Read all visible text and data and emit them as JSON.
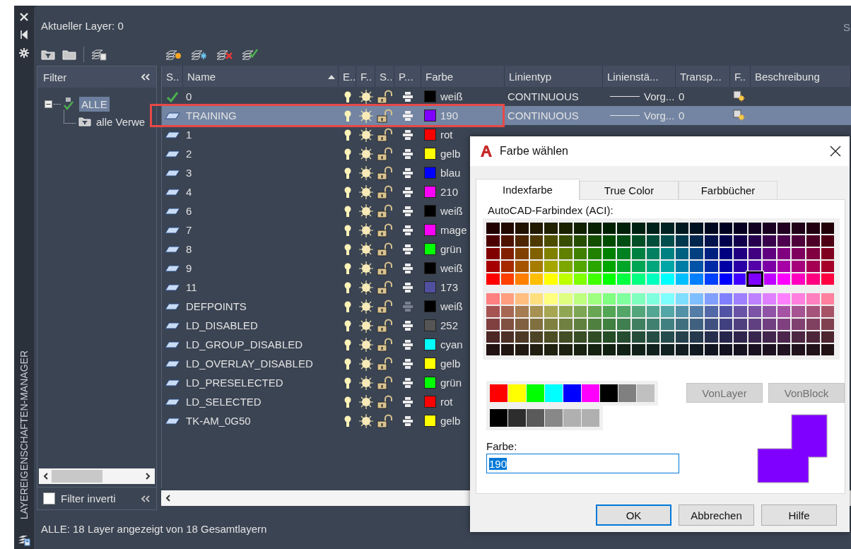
{
  "panel": {
    "title": "LAYEREIGENSCHAFTEN-MANAGER"
  },
  "current_layer": "Aktueller Layer: 0",
  "search": {
    "text": "S"
  },
  "filter_panel": {
    "title": "Filter",
    "tree": [
      {
        "label": "ALLE",
        "selected": true,
        "expanded": true,
        "children": [
          {
            "label": "alle Verwe",
            "selected": false
          }
        ]
      }
    ],
    "invert": {
      "label": "Filter inverti",
      "checked": false
    }
  },
  "table": {
    "columns": [
      {
        "label": "S..",
        "sorted": false
      },
      {
        "label": "Name",
        "sorted": true
      },
      {
        "label": "E..",
        "sorted": false
      },
      {
        "label": "F..",
        "sorted": false
      },
      {
        "label": "S..",
        "sorted": false
      },
      {
        "label": "P...",
        "sorted": false
      },
      {
        "label": "Farbe",
        "sorted": false
      },
      {
        "label": "Linientyp",
        "sorted": false
      },
      {
        "label": "Linienstä...",
        "sorted": false
      },
      {
        "label": "Transp...",
        "sorted": false
      },
      {
        "label": "F..",
        "sorted": false
      },
      {
        "label": "Beschreibung",
        "sorted": false
      }
    ],
    "rows": [
      {
        "name": "0",
        "current": true,
        "selected": false,
        "on": true,
        "frozen": false,
        "locked": false,
        "plot": true,
        "color": "#000000",
        "color_name": "weiß",
        "linetype": "CONTINUOUS",
        "lineweight": "Vorg...",
        "transparency": "0"
      },
      {
        "name": "TRAINING",
        "current": false,
        "selected": true,
        "on": true,
        "frozen": false,
        "locked": false,
        "plot": true,
        "color": "#8000ff",
        "color_name": "190",
        "linetype": "CONTINUOUS",
        "lineweight": "Vorg...",
        "transparency": "0"
      },
      {
        "name": "1",
        "current": false,
        "selected": false,
        "on": true,
        "frozen": false,
        "locked": false,
        "plot": true,
        "color": "#ff0000",
        "color_name": "rot"
      },
      {
        "name": "2",
        "current": false,
        "selected": false,
        "on": true,
        "frozen": false,
        "locked": false,
        "plot": true,
        "color": "#ffff00",
        "color_name": "gelb"
      },
      {
        "name": "3",
        "current": false,
        "selected": false,
        "on": true,
        "frozen": false,
        "locked": false,
        "plot": true,
        "color": "#0000ff",
        "color_name": "blau"
      },
      {
        "name": "4",
        "current": false,
        "selected": false,
        "on": true,
        "frozen": false,
        "locked": false,
        "plot": true,
        "color": "#ff00ff",
        "color_name": "210"
      },
      {
        "name": "6",
        "current": false,
        "selected": false,
        "on": true,
        "frozen": false,
        "locked": false,
        "plot": true,
        "color": "#000000",
        "color_name": "weiß"
      },
      {
        "name": "7",
        "current": false,
        "selected": false,
        "on": true,
        "frozen": false,
        "locked": false,
        "plot": true,
        "color": "#ff00ff",
        "color_name": "mage"
      },
      {
        "name": "8",
        "current": false,
        "selected": false,
        "on": true,
        "frozen": false,
        "locked": false,
        "plot": true,
        "color": "#00ff00",
        "color_name": "grün"
      },
      {
        "name": "9",
        "current": false,
        "selected": false,
        "on": true,
        "frozen": false,
        "locked": false,
        "plot": true,
        "color": "#000000",
        "color_name": "weiß"
      },
      {
        "name": "11",
        "current": false,
        "selected": false,
        "on": true,
        "frozen": false,
        "locked": false,
        "plot": true,
        "color": "#5050a0",
        "color_name": "173"
      },
      {
        "name": "DEFPOINTS",
        "current": false,
        "selected": false,
        "on": true,
        "frozen": false,
        "locked": false,
        "plot": false,
        "color": "#000000",
        "color_name": "weiß"
      },
      {
        "name": "LD_DISABLED",
        "current": false,
        "selected": false,
        "on": true,
        "frozen": false,
        "locked": false,
        "plot": true,
        "color": "#555555",
        "color_name": "252"
      },
      {
        "name": "LD_GROUP_DISABLED",
        "current": false,
        "selected": false,
        "on": true,
        "frozen": false,
        "locked": false,
        "plot": true,
        "color": "#00ffff",
        "color_name": "cyan"
      },
      {
        "name": "LD_OVERLAY_DISABLED",
        "current": false,
        "selected": false,
        "on": true,
        "frozen": false,
        "locked": false,
        "plot": true,
        "color": "#ffff00",
        "color_name": "gelb"
      },
      {
        "name": "LD_PRESELECTED",
        "current": false,
        "selected": false,
        "on": true,
        "frozen": false,
        "locked": false,
        "plot": true,
        "color": "#00ff00",
        "color_name": "grün"
      },
      {
        "name": "LD_SELECTED",
        "current": false,
        "selected": false,
        "on": true,
        "frozen": false,
        "locked": false,
        "plot": true,
        "color": "#ff0000",
        "color_name": "rot"
      },
      {
        "name": "TK-AM_0G50",
        "current": false,
        "selected": false,
        "on": true,
        "frozen": false,
        "locked": false,
        "plot": true,
        "color": "#ffff00",
        "color_name": "gelb"
      }
    ]
  },
  "status_bar": "ALLE: 18 Layer angezeigt von 18 Gesamtlayern",
  "dialog": {
    "title": "Farbe wählen",
    "tabs": [
      {
        "label": "Indexfarbe",
        "selected": true
      },
      {
        "label": "True Color",
        "selected": false
      },
      {
        "label": "Farbbücher",
        "selected": false
      }
    ],
    "palette_label": "AutoCAD-Farbindex (ACI):",
    "special_buttons": [
      {
        "label": "VonLayer",
        "disabled": true
      },
      {
        "label": "VonBlock",
        "disabled": true
      }
    ],
    "color_label": "Farbe:",
    "color_value": "190",
    "preview": {
      "color": "#8000ff"
    },
    "buttons": [
      {
        "label": "OK",
        "default": true
      },
      {
        "label": "Abbrechen",
        "default": false
      },
      {
        "label": "Hilfe",
        "default": false
      }
    ]
  }
}
